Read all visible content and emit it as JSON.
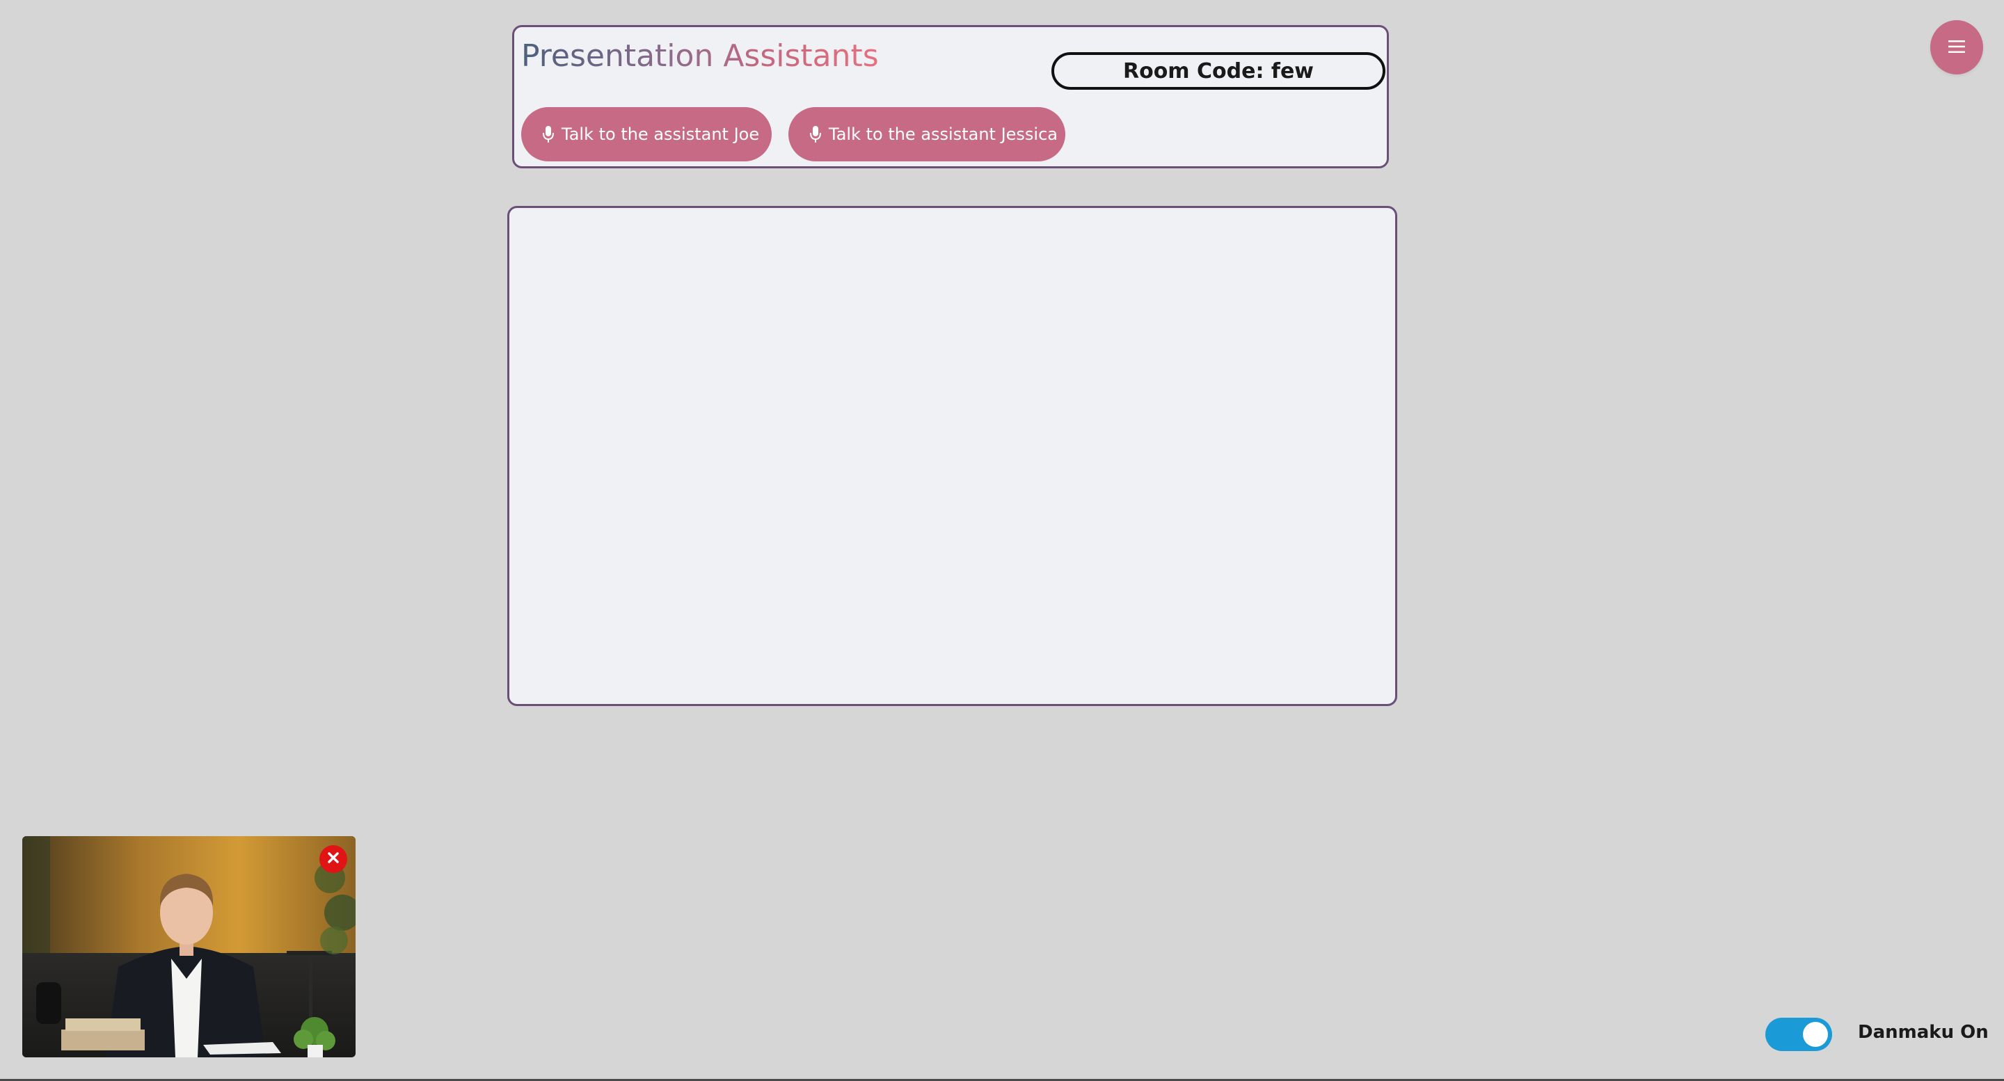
{
  "header": {
    "title": "Presentation Assistants",
    "room_code": "Room Code: few"
  },
  "assistants": [
    {
      "label": "Talk to the assistant Joe",
      "icon": "microphone-icon"
    },
    {
      "label": "Talk to the assistant Jessica",
      "icon": "microphone-icon"
    }
  ],
  "menu": {
    "icon": "hamburger-menu-icon"
  },
  "video": {
    "close_icon": "close-icon",
    "description_icon": "presenter-video"
  },
  "danmaku": {
    "label": "Danmaku On",
    "enabled": true
  },
  "colors": {
    "background": "#d6d6d6",
    "panel": "#f0f1f5",
    "panel_border": "#6b4f78",
    "accent_pink": "#c66a85",
    "toggle_blue": "#1a9ad6",
    "close_red": "#e01414"
  }
}
